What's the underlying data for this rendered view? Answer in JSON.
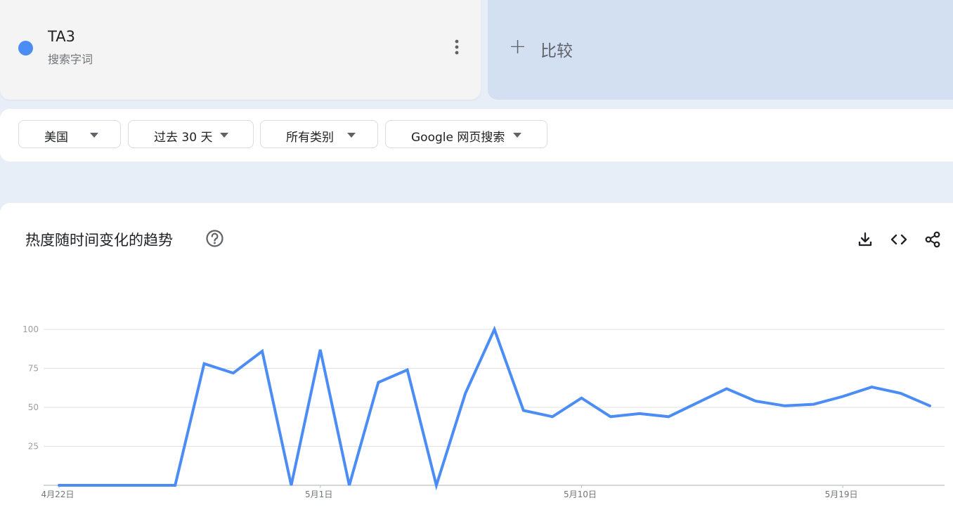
{
  "term": {
    "name": "TA3",
    "subtitle": "搜索字词",
    "color": "#4c8cf5"
  },
  "compare": {
    "label": "比较"
  },
  "filters": [
    {
      "label": "美国"
    },
    {
      "label": "过去 30 天"
    },
    {
      "label": "所有类别"
    },
    {
      "label": "Google 网页搜索"
    }
  ],
  "chart_section": {
    "title": "热度随时间变化的趋势",
    "icons": [
      "help-icon",
      "download-icon",
      "embed-icon",
      "share-icon"
    ]
  },
  "chart_data": {
    "type": "line",
    "title": "热度随时间变化的趋势",
    "xlabel": "",
    "ylabel": "",
    "ylim": [
      0,
      100
    ],
    "yticks": [
      25,
      50,
      75,
      100
    ],
    "xtick_labels": [
      {
        "label": "4月22日",
        "index": 0
      },
      {
        "label": "5月1日",
        "index": 9
      },
      {
        "label": "5月10日",
        "index": 18
      },
      {
        "label": "5月19日",
        "index": 27
      }
    ],
    "grid": true,
    "color": "#4c8cf5",
    "series": [
      {
        "values": [
          0,
          0,
          0,
          0,
          0,
          78,
          72,
          86,
          0,
          87,
          0,
          66,
          74,
          0,
          59,
          100,
          48,
          44,
          56,
          44,
          46,
          44,
          53,
          62,
          54,
          51,
          52,
          57,
          63,
          59,
          51
        ]
      }
    ]
  }
}
